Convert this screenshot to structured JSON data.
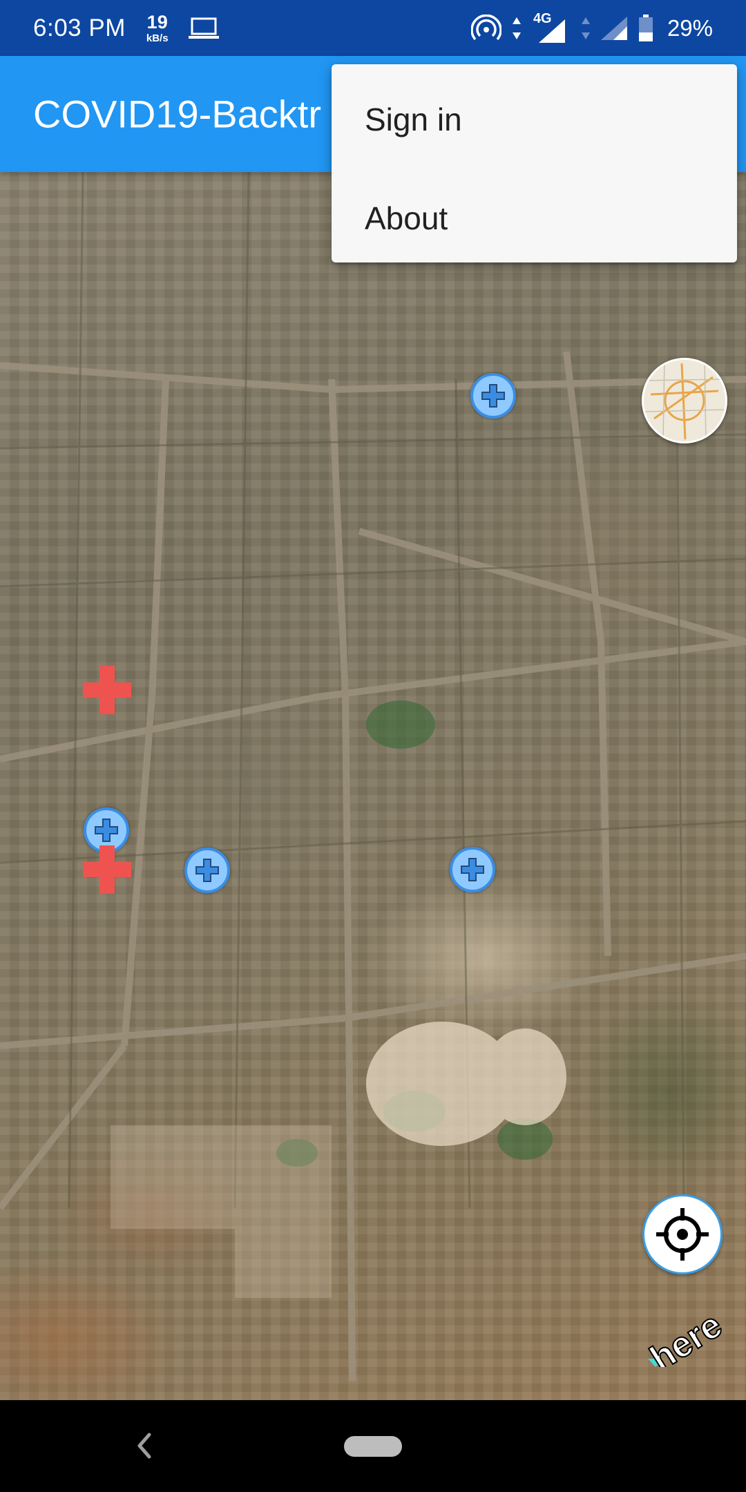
{
  "status_bar": {
    "time": "6:03 PM",
    "speed_value": "19",
    "speed_unit": "kB/s",
    "network": "4G",
    "battery_percent": "29%",
    "icons": [
      "laptop-icon",
      "hotspot-icon",
      "data-arrows-icon",
      "signal-icon",
      "battery-icon"
    ]
  },
  "app_bar": {
    "title": "COVID19-Backtr",
    "color": "#2196f3"
  },
  "menu": {
    "items": [
      {
        "label": "Sign in"
      },
      {
        "label": "About"
      }
    ]
  },
  "map": {
    "markers": {
      "hospital_blue_count": 4,
      "red_cross_count": 2
    },
    "attribution": "here",
    "icons": [
      "hospital-marker-icon",
      "red-cross-icon",
      "mini-map-icon",
      "crosshair-icon",
      "here-logo"
    ]
  },
  "nav_bar": {
    "icons": [
      "back-icon",
      "home-pill"
    ]
  },
  "colors": {
    "status_bar": "#0d47a1",
    "app_bar": "#2196f3",
    "marker_blue": "#8ec9ff",
    "marker_red": "#ef5350"
  }
}
